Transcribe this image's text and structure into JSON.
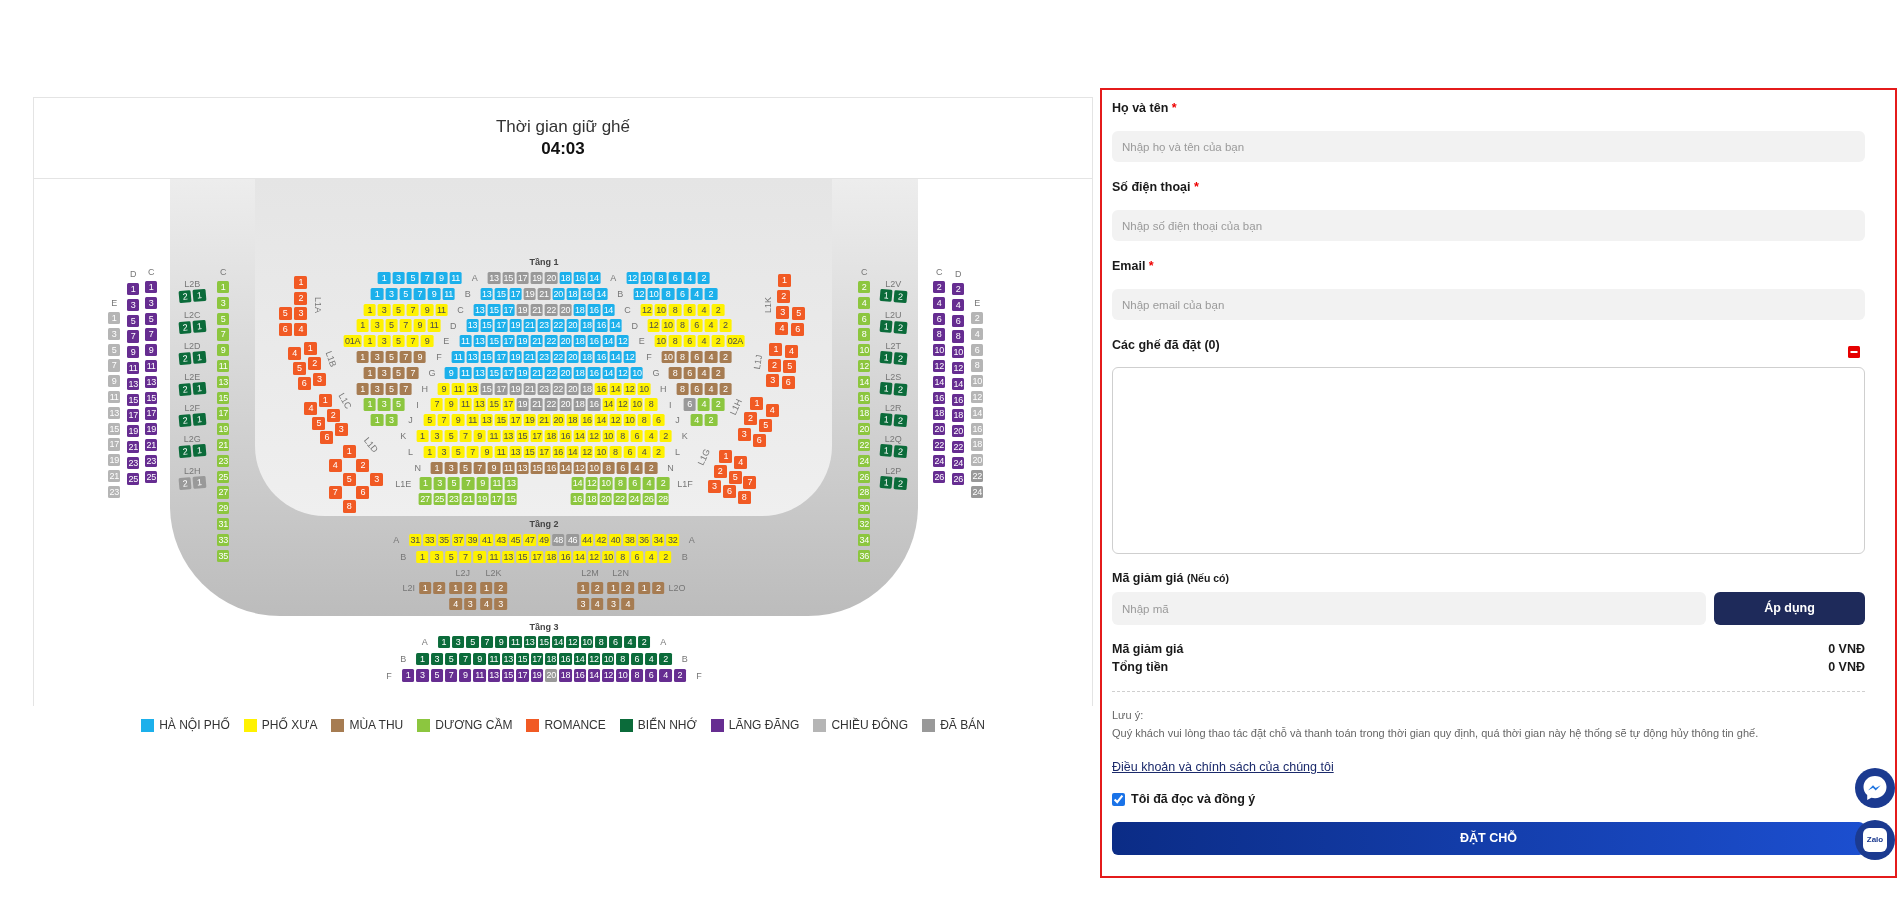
{
  "hold_timer": {
    "title": "Thời gian giữ ghế",
    "time": "04:03"
  },
  "seat_map": {
    "left_columns": [
      {
        "header": "E",
        "segments": [
          {
            "color": "#b5b5b5",
            "seats": [
              "1",
              "3",
              "5",
              "7",
              "9",
              "11",
              "13",
              "15",
              "17",
              "19",
              "21",
              "23"
            ]
          }
        ]
      },
      {
        "header": "D",
        "segments": [
          {
            "color": "#662d91",
            "seats": [
              "1",
              "3",
              "5",
              "7",
              "9",
              "11",
              "13",
              "15",
              "17",
              "19",
              "21",
              "23",
              "25"
            ]
          }
        ]
      },
      {
        "header": "C",
        "segments": [
          {
            "color": "#662d91",
            "seats": [
              "1",
              "3",
              "5",
              "7",
              "9",
              "11",
              "13",
              "15",
              "17",
              "19",
              "21",
              "23",
              "25"
            ]
          }
        ]
      }
    ],
    "left_boxes": [
      {
        "label": "L2B",
        "color": "#0b6b3a",
        "seats": [
          "2",
          "1"
        ]
      },
      {
        "label": "L2C",
        "color": "#0b6b3a",
        "seats": [
          "2",
          "1"
        ]
      },
      {
        "label": "L2D",
        "color": "#0b6b3a",
        "seats": [
          "2",
          "1"
        ]
      },
      {
        "label": "L2E",
        "color": "#0b6b3a",
        "seats": [
          "2",
          "1"
        ]
      },
      {
        "label": "L2F",
        "color": "#0b6b3a",
        "seats": [
          "2",
          "1"
        ]
      },
      {
        "label": "L2G",
        "color": "#0b6b3a",
        "seats": [
          "2",
          "1"
        ]
      },
      {
        "label": "L2H",
        "color": "#999999",
        "seats": [
          "2",
          "1"
        ]
      }
    ],
    "left_aisle": {
      "header": "C",
      "segments": [
        {
          "color": "#8cc63f",
          "seats": [
            "1",
            "3",
            "5",
            "7",
            "9",
            "11",
            "13",
            "15",
            "17",
            "19",
            "21",
            "23",
            "25",
            "27",
            "29",
            "31",
            "33",
            "35"
          ]
        }
      ]
    },
    "left_wings": [
      {
        "label": "L1A",
        "color": "#f15a24",
        "seats": [
          "1",
          "2",
          "5",
          "3",
          "6",
          "4"
        ]
      },
      {
        "label": "L1B",
        "color": "#f15a24",
        "seats": [
          "4",
          "1",
          "5",
          "2",
          "6",
          "3"
        ]
      },
      {
        "label": "L1C",
        "color": "#f15a24",
        "seats": [
          "4",
          "1",
          "5",
          "2",
          "6",
          "3"
        ]
      },
      {
        "label": "L1D",
        "color": "#f15a24",
        "seats": [
          "1",
          "2",
          "3",
          "4",
          "5",
          "6",
          "7",
          "8"
        ]
      }
    ],
    "tier_1": {
      "title": "Tầng 1",
      "rows": [
        {
          "parts": [
            {
              "kind": "seats",
              "segments": [
                {
                  "color": "#1cb0eb",
                  "seats": [
                    "1",
                    "3",
                    "5",
                    "7",
                    "9",
                    "11"
                  ]
                }
              ]
            },
            {
              "kind": "label",
              "text": "A"
            },
            {
              "kind": "seats",
              "segments": [
                {
                  "color": "#999999",
                  "seats": [
                    "13",
                    "15",
                    "17",
                    "19",
                    "20"
                  ]
                },
                {
                  "color": "#1cb0eb",
                  "seats": [
                    "18",
                    "16",
                    "14"
                  ]
                }
              ]
            },
            {
              "kind": "label",
              "text": "A"
            },
            {
              "kind": "seats",
              "segments": [
                {
                  "color": "#1cb0eb",
                  "seats": [
                    "12",
                    "10",
                    "8",
                    "6",
                    "4",
                    "2"
                  ]
                }
              ]
            }
          ]
        },
        {
          "parts": [
            {
              "kind": "seats",
              "segments": [
                {
                  "color": "#1cb0eb",
                  "seats": [
                    "1",
                    "3",
                    "5",
                    "7",
                    "9",
                    "11"
                  ]
                }
              ]
            },
            {
              "kind": "label",
              "text": "B"
            },
            {
              "kind": "seats",
              "segments": [
                {
                  "color": "#1cb0eb",
                  "seats": [
                    "13",
                    "15",
                    "17"
                  ]
                },
                {
                  "color": "#999999",
                  "seats": [
                    "19",
                    "21"
                  ]
                },
                {
                  "color": "#1cb0eb",
                  "seats": [
                    "20",
                    "18",
                    "16",
                    "14"
                  ]
                }
              ]
            },
            {
              "kind": "label",
              "text": "B"
            },
            {
              "kind": "seats",
              "segments": [
                {
                  "color": "#1cb0eb",
                  "seats": [
                    "12",
                    "10",
                    "8",
                    "6",
                    "4",
                    "2"
                  ]
                }
              ]
            }
          ]
        },
        {
          "parts": [
            {
              "kind": "seats",
              "segments": [
                {
                  "color": "#fff200",
                  "seats": [
                    "1",
                    "3",
                    "5",
                    "7",
                    "9",
                    "11"
                  ]
                }
              ]
            },
            {
              "kind": "label",
              "text": "C"
            },
            {
              "kind": "seats",
              "segments": [
                {
                  "color": "#1cb0eb",
                  "seats": [
                    "13",
                    "15",
                    "17"
                  ]
                },
                {
                  "color": "#999999",
                  "seats": [
                    "19",
                    "21",
                    "22",
                    "20"
                  ]
                },
                {
                  "color": "#1cb0eb",
                  "seats": [
                    "18",
                    "16",
                    "14"
                  ]
                }
              ]
            },
            {
              "kind": "label",
              "text": "C"
            },
            {
              "kind": "seats",
              "segments": [
                {
                  "color": "#fff200",
                  "seats": [
                    "12",
                    "10",
                    "8",
                    "6",
                    "4",
                    "2"
                  ]
                }
              ]
            }
          ]
        },
        {
          "parts": [
            {
              "kind": "seats",
              "segments": [
                {
                  "color": "#fff200",
                  "seats": [
                    "1",
                    "3",
                    "5",
                    "7",
                    "9",
                    "11"
                  ]
                }
              ]
            },
            {
              "kind": "label",
              "text": "D"
            },
            {
              "kind": "seats",
              "segments": [
                {
                  "color": "#1cb0eb",
                  "seats": [
                    "13",
                    "15",
                    "17",
                    "19",
                    "21",
                    "23",
                    "22",
                    "20",
                    "18",
                    "16",
                    "14"
                  ]
                }
              ]
            },
            {
              "kind": "label",
              "text": "D"
            },
            {
              "kind": "seats",
              "segments": [
                {
                  "color": "#fff200",
                  "seats": [
                    "12",
                    "10",
                    "8",
                    "6",
                    "4",
                    "2"
                  ]
                }
              ]
            }
          ]
        },
        {
          "parts": [
            {
              "kind": "seats",
              "segments": [
                {
                  "color": "#fff200",
                  "seats": [
                    "01A",
                    "1",
                    "3",
                    "5",
                    "7",
                    "9"
                  ]
                }
              ]
            },
            {
              "kind": "label",
              "text": "E"
            },
            {
              "kind": "seats",
              "segments": [
                {
                  "color": "#1cb0eb",
                  "seats": [
                    "11",
                    "13",
                    "15",
                    "17",
                    "19",
                    "21",
                    "22",
                    "20",
                    "18",
                    "16",
                    "14",
                    "12"
                  ]
                }
              ]
            },
            {
              "kind": "label",
              "text": "E"
            },
            {
              "kind": "seats",
              "segments": [
                {
                  "color": "#fff200",
                  "seats": [
                    "10",
                    "8",
                    "6",
                    "4",
                    "2",
                    "02A"
                  ]
                }
              ]
            }
          ]
        },
        {
          "parts": [
            {
              "kind": "seats",
              "segments": [
                {
                  "color": "#a67c52",
                  "seats": [
                    "1",
                    "3",
                    "5",
                    "7",
                    "9"
                  ]
                }
              ]
            },
            {
              "kind": "label",
              "text": "F"
            },
            {
              "kind": "seats",
              "segments": [
                {
                  "color": "#1cb0eb",
                  "seats": [
                    "11",
                    "13",
                    "15",
                    "17",
                    "19",
                    "21",
                    "23",
                    "22",
                    "20",
                    "18",
                    "16",
                    "14",
                    "12"
                  ]
                }
              ]
            },
            {
              "kind": "label",
              "text": "F"
            },
            {
              "kind": "seats",
              "segments": [
                {
                  "color": "#a67c52",
                  "seats": [
                    "10",
                    "8",
                    "6",
                    "4",
                    "2"
                  ]
                }
              ]
            }
          ]
        },
        {
          "parts": [
            {
              "kind": "seats",
              "segments": [
                {
                  "color": "#a67c52",
                  "seats": [
                    "1",
                    "3",
                    "5",
                    "7"
                  ]
                }
              ]
            },
            {
              "kind": "label",
              "text": "G"
            },
            {
              "kind": "seats",
              "segments": [
                {
                  "color": "#1cb0eb",
                  "seats": [
                    "9",
                    "11",
                    "13",
                    "15",
                    "17",
                    "19",
                    "21",
                    "22",
                    "20",
                    "18",
                    "16",
                    "14",
                    "12",
                    "10"
                  ]
                }
              ]
            },
            {
              "kind": "label",
              "text": "G"
            },
            {
              "kind": "seats",
              "segments": [
                {
                  "color": "#a67c52",
                  "seats": [
                    "8",
                    "6",
                    "4",
                    "2"
                  ]
                }
              ]
            }
          ]
        },
        {
          "parts": [
            {
              "kind": "seats",
              "segments": [
                {
                  "color": "#a67c52",
                  "seats": [
                    "1",
                    "3",
                    "5",
                    "7"
                  ]
                }
              ]
            },
            {
              "kind": "label",
              "text": "H"
            },
            {
              "kind": "seats",
              "segments": [
                {
                  "color": "#fff200",
                  "seats": [
                    "9",
                    "11",
                    "13"
                  ]
                },
                {
                  "color": "#999999",
                  "seats": [
                    "15",
                    "17",
                    "19",
                    "21",
                    "23",
                    "22",
                    "20",
                    "18"
                  ]
                },
                {
                  "color": "#fff200",
                  "seats": [
                    "16",
                    "14",
                    "12",
                    "10"
                  ]
                }
              ]
            },
            {
              "kind": "label",
              "text": "H"
            },
            {
              "kind": "seats",
              "segments": [
                {
                  "color": "#a67c52",
                  "seats": [
                    "8",
                    "6",
                    "4",
                    "2"
                  ]
                }
              ]
            }
          ]
        },
        {
          "parts": [
            {
              "kind": "seats",
              "segments": [
                {
                  "color": "#8cc63f",
                  "seats": [
                    "1",
                    "3",
                    "5"
                  ]
                }
              ]
            },
            {
              "kind": "label",
              "text": "I"
            },
            {
              "kind": "seats",
              "segments": [
                {
                  "color": "#fff200",
                  "seats": [
                    "7",
                    "9",
                    "11",
                    "13",
                    "15",
                    "17"
                  ]
                },
                {
                  "color": "#999999",
                  "seats": [
                    "19",
                    "21",
                    "22",
                    "20",
                    "18",
                    "16"
                  ]
                },
                {
                  "color": "#fff200",
                  "seats": [
                    "14",
                    "12",
                    "10",
                    "8"
                  ]
                }
              ]
            },
            {
              "kind": "label",
              "text": "I"
            },
            {
              "kind": "seats",
              "segments": [
                {
                  "color": "#999999",
                  "seats": [
                    "6"
                  ]
                },
                {
                  "color": "#8cc63f",
                  "seats": [
                    "4",
                    "2"
                  ]
                }
              ]
            }
          ]
        },
        {
          "parts": [
            {
              "kind": "seats",
              "segments": [
                {
                  "color": "#8cc63f",
                  "seats": [
                    "1",
                    "3"
                  ]
                }
              ]
            },
            {
              "kind": "label",
              "text": "J"
            },
            {
              "kind": "seats",
              "segments": [
                {
                  "color": "#fff200",
                  "seats": [
                    "5",
                    "7",
                    "9",
                    "11",
                    "13",
                    "15",
                    "17",
                    "19",
                    "21",
                    "20",
                    "18",
                    "16",
                    "14",
                    "12",
                    "10",
                    "8",
                    "6"
                  ]
                }
              ]
            },
            {
              "kind": "label",
              "text": "J"
            },
            {
              "kind": "seats",
              "segments": [
                {
                  "color": "#8cc63f",
                  "seats": [
                    "4",
                    "2"
                  ]
                }
              ]
            }
          ]
        },
        {
          "parts": [
            {
              "kind": "label",
              "text": "K"
            },
            {
              "kind": "seats",
              "segments": [
                {
                  "color": "#fff200",
                  "seats": [
                    "1",
                    "3",
                    "5",
                    "7",
                    "9",
                    "11",
                    "13",
                    "15",
                    "17",
                    "18",
                    "16",
                    "14",
                    "12",
                    "10",
                    "8",
                    "6",
                    "4",
                    "2"
                  ]
                }
              ]
            },
            {
              "kind": "label",
              "text": "K"
            }
          ]
        },
        {
          "parts": [
            {
              "kind": "label",
              "text": "L"
            },
            {
              "kind": "seats",
              "segments": [
                {
                  "color": "#fff200",
                  "seats": [
                    "1",
                    "3",
                    "5",
                    "7",
                    "9",
                    "11",
                    "13",
                    "15",
                    "17",
                    "16",
                    "14",
                    "12",
                    "10",
                    "8",
                    "6",
                    "4",
                    "2"
                  ]
                }
              ]
            },
            {
              "kind": "label",
              "text": "L"
            }
          ]
        },
        {
          "parts": [
            {
              "kind": "label",
              "text": "N"
            },
            {
              "kind": "seats",
              "segments": [
                {
                  "color": "#a67c52",
                  "seats": [
                    "1",
                    "3",
                    "5",
                    "7",
                    "9",
                    "11",
                    "13",
                    "15",
                    "16",
                    "14",
                    "12",
                    "10",
                    "8",
                    "6",
                    "4",
                    "2"
                  ]
                }
              ]
            },
            {
              "kind": "label",
              "text": "N"
            }
          ]
        },
        {
          "parts": [
            {
              "kind": "label",
              "text": "L1E"
            },
            {
              "kind": "seats",
              "segments": [
                {
                  "color": "#8cc63f",
                  "seats": [
                    "1",
                    "3",
                    "5",
                    "7",
                    "9",
                    "11",
                    "13"
                  ]
                }
              ]
            },
            {
              "kind": "seats",
              "segments": [
                {
                  "color": "#8cc63f",
                  "seats": [
                    "14",
                    "12",
                    "10",
                    "8",
                    "6",
                    "4",
                    "2"
                  ]
                }
              ]
            },
            {
              "kind": "label",
              "text": "L1F"
            }
          ]
        },
        {
          "parts": [
            {
              "kind": "seats",
              "segments": [
                {
                  "color": "#8cc63f",
                  "seats": [
                    "27",
                    "25",
                    "23",
                    "21",
                    "19",
                    "17",
                    "15"
                  ]
                }
              ]
            },
            {
              "kind": "seats",
              "segments": [
                {
                  "color": "#8cc63f",
                  "seats": [
                    "16",
                    "18",
                    "20",
                    "22",
                    "24",
                    "26",
                    "28"
                  ]
                }
              ]
            }
          ]
        }
      ]
    },
    "right_wings": [
      {
        "label": "L1K",
        "color": "#f15a24",
        "seats": [
          "1",
          "2",
          "3",
          "5",
          "4",
          "6"
        ]
      },
      {
        "label": "L1J",
        "color": "#f15a24",
        "seats": [
          "1",
          "4",
          "2",
          "5",
          "3",
          "6"
        ]
      },
      {
        "label": "L1H",
        "color": "#f15a24",
        "seats": [
          "1",
          "4",
          "2",
          "5",
          "3",
          "6"
        ]
      },
      {
        "label": "L1G",
        "color": "#f15a24",
        "seats": [
          "1",
          "4",
          "2",
          "5",
          "7",
          "3",
          "6",
          "8"
        ]
      }
    ],
    "right_aisle": {
      "header": "C",
      "segments": [
        {
          "color": "#8cc63f",
          "seats": [
            "2",
            "4",
            "6",
            "8",
            "10",
            "12",
            "14",
            "16",
            "18",
            "20",
            "22",
            "24",
            "26",
            "28",
            "30",
            "32",
            "34",
            "36"
          ]
        }
      ]
    },
    "right_boxes": [
      {
        "label": "L2V",
        "color": "#0b6b3a",
        "seats": [
          "1",
          "2"
        ]
      },
      {
        "label": "L2U",
        "color": "#0b6b3a",
        "seats": [
          "1",
          "2"
        ]
      },
      {
        "label": "L2T",
        "color": "#0b6b3a",
        "seats": [
          "1",
          "2"
        ]
      },
      {
        "label": "L2S",
        "color": "#0b6b3a",
        "seats": [
          "1",
          "2"
        ]
      },
      {
        "label": "L2R",
        "color": "#0b6b3a",
        "seats": [
          "1",
          "2"
        ]
      },
      {
        "label": "L2Q",
        "color": "#0b6b3a",
        "seats": [
          "1",
          "2"
        ]
      },
      {
        "label": "L2P",
        "color": "#0b6b3a",
        "seats": [
          "1",
          "2"
        ]
      }
    ],
    "right_columns": [
      {
        "header": "C",
        "segments": [
          {
            "color": "#662d91",
            "seats": [
              "2",
              "4",
              "6",
              "8",
              "10",
              "12",
              "14",
              "16",
              "18",
              "20",
              "22",
              "24",
              "26"
            ]
          }
        ]
      },
      {
        "header": "D",
        "segments": [
          {
            "color": "#662d91",
            "seats": [
              "2",
              "4",
              "6",
              "8",
              "10",
              "12",
              "14",
              "16",
              "18",
              "20",
              "22",
              "24",
              "26"
            ]
          }
        ]
      },
      {
        "header": "E",
        "segments": [
          {
            "color": "#b5b5b5",
            "seats": [
              "2",
              "4",
              "6",
              "8",
              "10",
              "12",
              "14",
              "16",
              "18",
              "20"
            ]
          },
          {
            "color": "#999999",
            "seats": [
              "22",
              "24"
            ]
          }
        ]
      }
    ],
    "tier_2": {
      "title": "Tầng 2",
      "rows": [
        {
          "parts": [
            {
              "kind": "label",
              "text": "A"
            },
            {
              "kind": "seats",
              "segments": [
                {
                  "color": "#fff200",
                  "seats": [
                    "31",
                    "33",
                    "35",
                    "37",
                    "39",
                    "41",
                    "43",
                    "45",
                    "47",
                    "49"
                  ]
                },
                {
                  "color": "#999999",
                  "seats": [
                    "48",
                    "46"
                  ]
                },
                {
                  "color": "#fff200",
                  "seats": [
                    "44",
                    "42",
                    "40",
                    "38",
                    "36",
                    "34",
                    "32"
                  ]
                }
              ]
            },
            {
              "kind": "label",
              "text": "A"
            }
          ]
        },
        {
          "parts": [
            {
              "kind": "label",
              "text": "B"
            },
            {
              "kind": "seats",
              "segments": [
                {
                  "color": "#fff200",
                  "seats": [
                    "1",
                    "3",
                    "5",
                    "7",
                    "9",
                    "11",
                    "13",
                    "15",
                    "17",
                    "18",
                    "16",
                    "14",
                    "12",
                    "10",
                    "8",
                    "6",
                    "4",
                    "2"
                  ]
                }
              ]
            },
            {
              "kind": "label",
              "text": "B"
            }
          ]
        }
      ],
      "box_groups": [
        [
          {
            "label": "L2I",
            "kind": "label-left",
            "color": "#a67c52",
            "rows": [
              [
                "1",
                "2"
              ]
            ]
          },
          {
            "label": "L2J",
            "kind": "label-top",
            "color": "#a67c52",
            "rows": [
              [
                "1",
                "2"
              ],
              [
                "4",
                "3"
              ]
            ]
          },
          {
            "label": "L2K",
            "kind": "label-top",
            "color": "#a67c52",
            "rows": [
              [
                "1",
                "2"
              ],
              [
                "4",
                "3"
              ]
            ]
          }
        ],
        [
          {
            "label": "L2M",
            "kind": "label-top",
            "color": "#a67c52",
            "rows": [
              [
                "1",
                "2"
              ],
              [
                "3",
                "4"
              ]
            ]
          },
          {
            "label": "L2N",
            "kind": "label-top",
            "color": "#a67c52",
            "rows": [
              [
                "1",
                "2"
              ],
              [
                "3",
                "4"
              ]
            ]
          },
          {
            "label": "L2O",
            "kind": "label-right",
            "color": "#a67c52",
            "rows": [
              [
                "1",
                "2"
              ]
            ]
          }
        ]
      ]
    },
    "tier_3": {
      "title": "Tầng 3",
      "rows": [
        {
          "parts": [
            {
              "kind": "label",
              "text": "A"
            },
            {
              "kind": "seats",
              "segments": [
                {
                  "color": "#0b6b3a",
                  "seats": [
                    "1",
                    "3",
                    "5",
                    "7",
                    "9",
                    "11",
                    "13",
                    "15",
                    "14",
                    "12",
                    "10",
                    "8",
                    "6",
                    "4",
                    "2"
                  ]
                }
              ]
            },
            {
              "kind": "label",
              "text": "A"
            }
          ]
        },
        {
          "parts": [
            {
              "kind": "label",
              "text": "B"
            },
            {
              "kind": "seats",
              "segments": [
                {
                  "color": "#0b6b3a",
                  "seats": [
                    "1",
                    "3",
                    "5",
                    "7",
                    "9",
                    "11",
                    "13",
                    "15",
                    "17",
                    "18",
                    "16",
                    "14",
                    "12",
                    "10",
                    "8",
                    "6",
                    "4",
                    "2"
                  ]
                }
              ]
            },
            {
              "kind": "label",
              "text": "B"
            }
          ]
        },
        {
          "parts": [
            {
              "kind": "label",
              "text": "F"
            },
            {
              "kind": "seats",
              "segments": [
                {
                  "color": "#662d91",
                  "seats": [
                    "1",
                    "3",
                    "5",
                    "7",
                    "9",
                    "11",
                    "13",
                    "15",
                    "17",
                    "19"
                  ]
                },
                {
                  "color": "#999999",
                  "seats": [
                    "20"
                  ]
                },
                {
                  "color": "#662d91",
                  "seats": [
                    "18",
                    "16",
                    "14",
                    "12",
                    "10",
                    "8",
                    "6",
                    "4",
                    "2"
                  ]
                }
              ]
            },
            {
              "kind": "label",
              "text": "F"
            }
          ]
        }
      ]
    }
  },
  "legend": [
    {
      "label": "HÀ NỘI PHỐ",
      "color": "#1cb0eb"
    },
    {
      "label": "PHỐ XƯA",
      "color": "#fff200"
    },
    {
      "label": "MÙA THU",
      "color": "#a67c52"
    },
    {
      "label": "DƯƠNG CẦM",
      "color": "#8cc63f"
    },
    {
      "label": "ROMANCE",
      "color": "#f15a24"
    },
    {
      "label": "BIỂN NHỚ",
      "color": "#0b6b3a"
    },
    {
      "label": "LÃNG ĐÃNG",
      "color": "#662d91"
    },
    {
      "label": "CHIỀU ĐÔNG",
      "color": "#b5b5b5"
    },
    {
      "label": "ĐÃ BÁN",
      "color": "#999999"
    }
  ],
  "booking_form": {
    "fields": [
      {
        "label": "Họ và tên",
        "required_mark": "*",
        "placeholder": "Nhập họ và tên của bạn"
      },
      {
        "label": "Số điện thoại",
        "required_mark": "*",
        "placeholder": "Nhập số điện thoại của bạn"
      },
      {
        "label": "Email",
        "required_mark": "*",
        "placeholder": "Nhập email của bạn"
      }
    ],
    "selected_seats": {
      "label": "Các ghế đã đặt (0)"
    },
    "discount": {
      "label": "Mã giảm giá",
      "note": "(Nếu có)",
      "placeholder": "Nhập mã",
      "button": "Áp dụng"
    },
    "summary": [
      {
        "label": "Mã giảm giá",
        "value": "0 VNĐ"
      },
      {
        "label": "Tổng tiền",
        "value": "0 VNĐ"
      }
    ],
    "notice": {
      "title": "Lưu ý:",
      "text": "Quý khách vui lòng thao tác đặt chỗ và thanh toán trong thời gian quy định, quá thời gian này hệ thống sẽ tự động hủy thông tin ghế."
    },
    "terms_link": "Điều khoản và chính sách của chúng tôi",
    "agreement": {
      "label": "Tôi đã đọc và đồng ý",
      "checked": true
    },
    "submit_button": "ĐẶT CHỖ"
  },
  "floating_buttons": [
    {
      "kind": "messenger"
    },
    {
      "kind": "zalo",
      "text": "Zalo"
    }
  ]
}
